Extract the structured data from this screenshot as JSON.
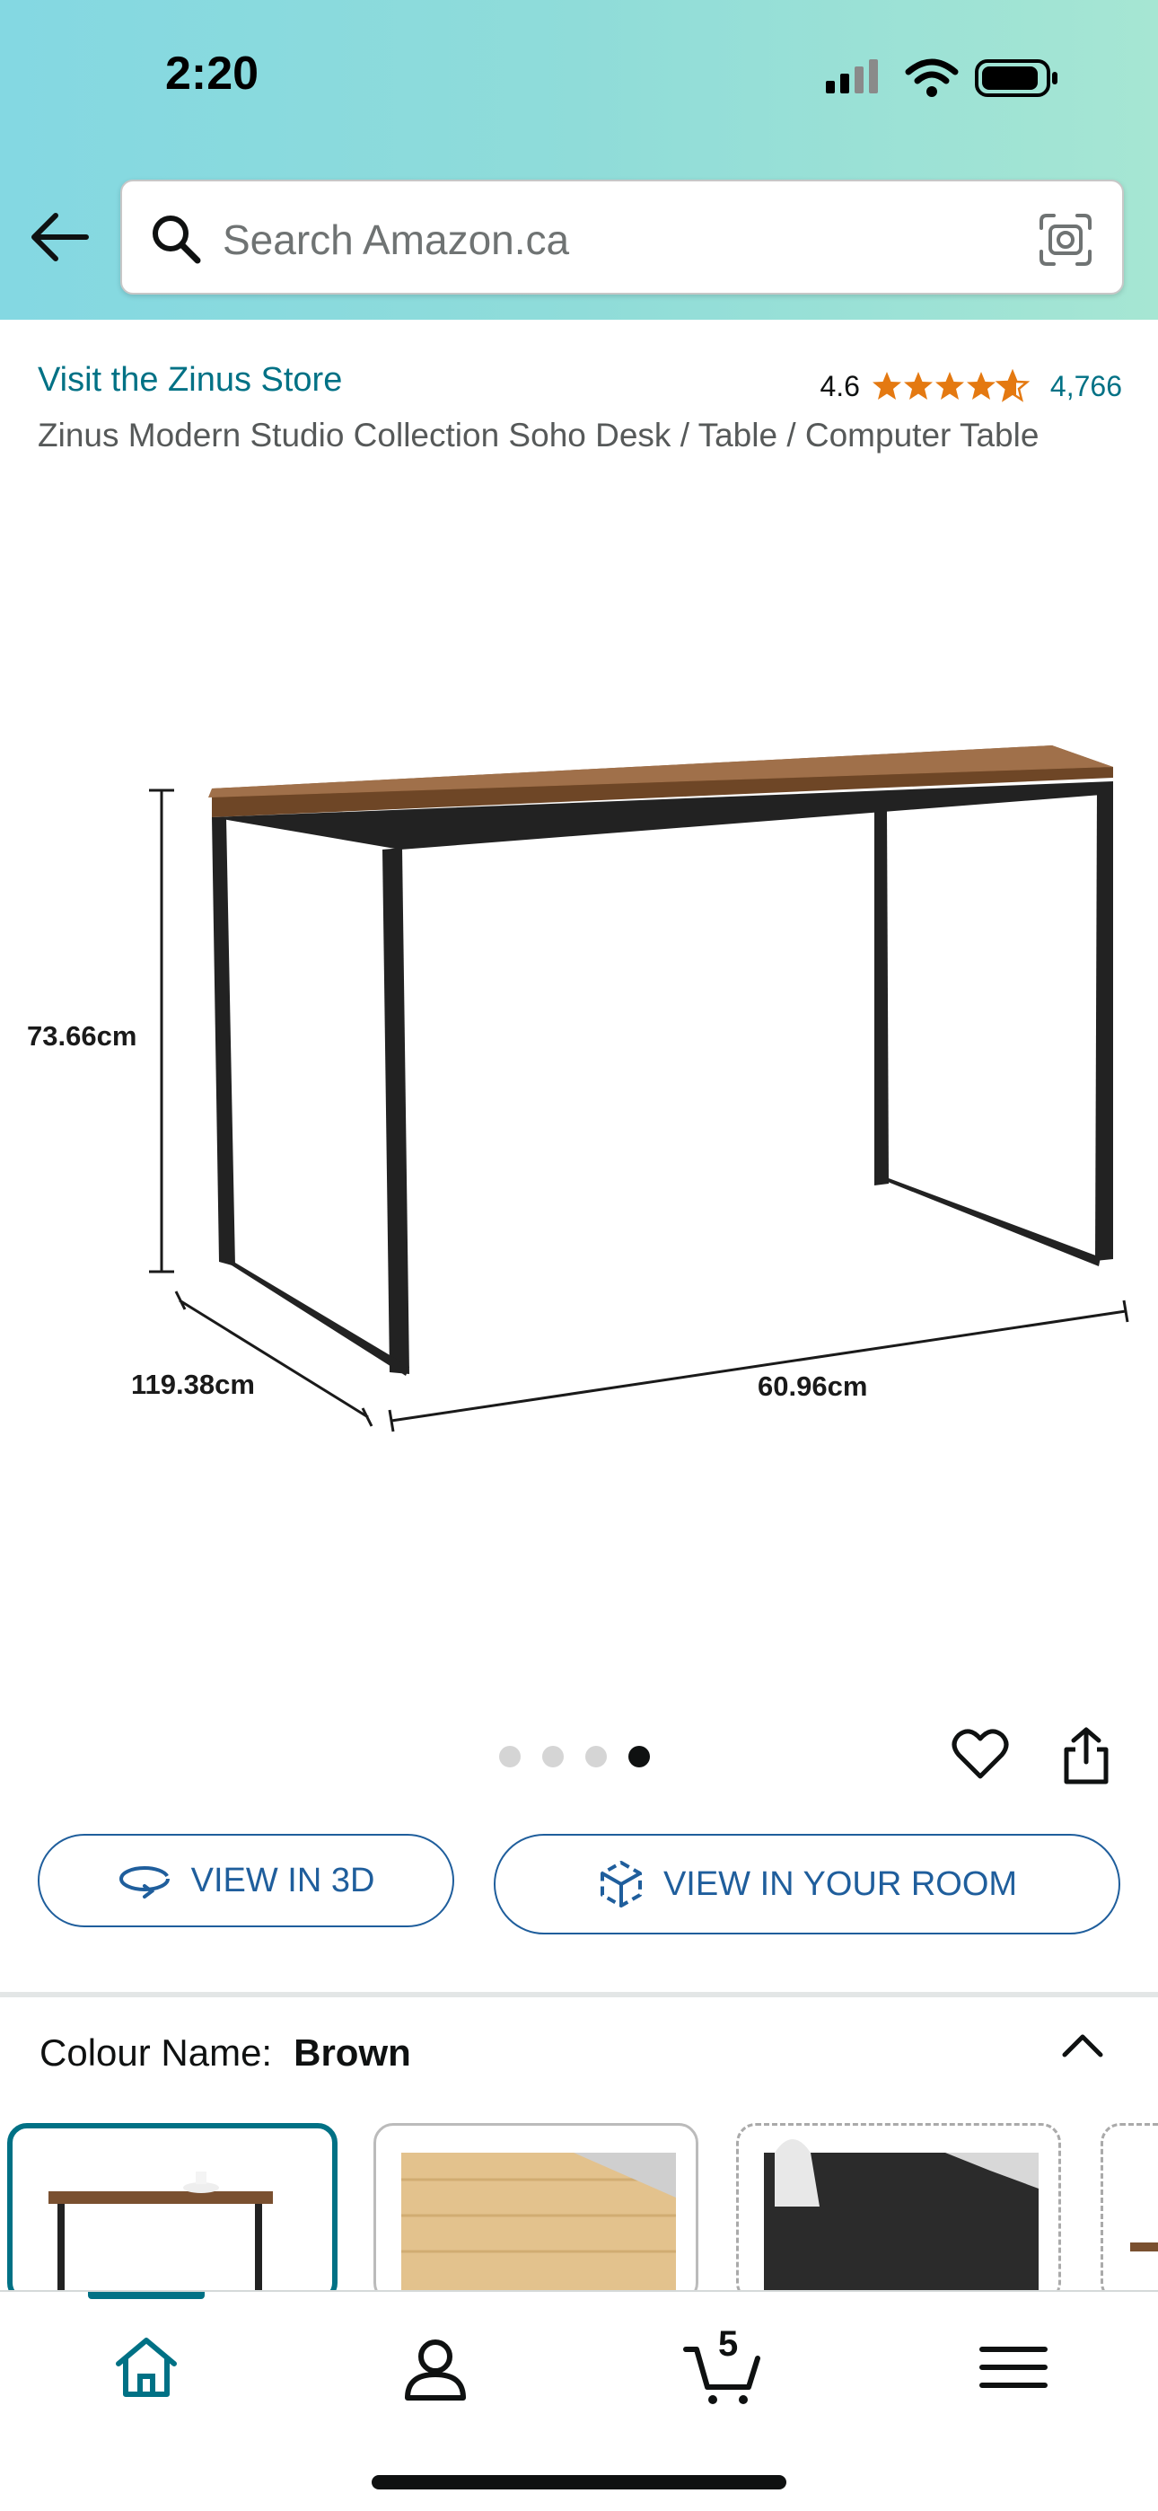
{
  "status_bar": {
    "time": "2:20"
  },
  "search": {
    "placeholder": "Search Amazon.ca"
  },
  "product": {
    "store_link": "Visit the Zinus Store",
    "rating": "4.6",
    "rating_count": "4,766",
    "title": "Zinus Modern Studio Collection Soho Desk / Table / Computer Table"
  },
  "image": {
    "dimensions": {
      "height": "73.66cm",
      "depth": "119.38cm",
      "width": "60.96cm"
    },
    "gallery_count": 4,
    "active_index": 3
  },
  "actions": {
    "view_3d_label": "VIEW IN 3D",
    "view_room_label": "VIEW IN YOUR ROOM"
  },
  "colour": {
    "label": "Colour Name:",
    "value": "Brown"
  },
  "nav": {
    "cart_count": "5"
  },
  "colors": {
    "accent": "#007185",
    "button_blue": "#1f5e9c",
    "star": "#e47911"
  }
}
